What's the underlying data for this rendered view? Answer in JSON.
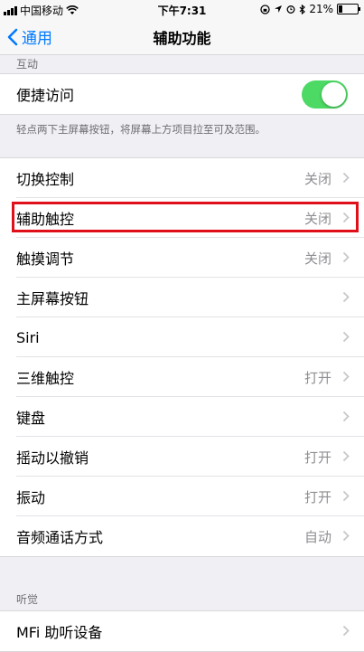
{
  "status": {
    "carrier": "中国移动",
    "time": "下午7:31",
    "battery": "21%",
    "battery_level": 0.21
  },
  "nav": {
    "back_label": "通用",
    "title": "辅助功能"
  },
  "section_interaction": {
    "header": "互动",
    "toggle_row": {
      "label": "便捷访问",
      "toggle_on": true
    },
    "footer": "轻点两下主屏幕按钮，将屏幕上方项目拉至可及范围。"
  },
  "list": [
    {
      "label": "切换控制",
      "value": "关闭"
    },
    {
      "label": "辅助触控",
      "value": "关闭"
    },
    {
      "label": "触摸调节",
      "value": "关闭"
    },
    {
      "label": "主屏幕按钮",
      "value": ""
    },
    {
      "label": "Siri",
      "value": ""
    },
    {
      "label": "三维触控",
      "value": "打开"
    },
    {
      "label": "键盘",
      "value": ""
    },
    {
      "label": "摇动以撤销",
      "value": "打开"
    },
    {
      "label": "振动",
      "value": "打开"
    },
    {
      "label": "音频通话方式",
      "value": "自动"
    }
  ],
  "section_hearing": {
    "header": "听觉",
    "rows": [
      {
        "label": "MFi 助听设备",
        "value": ""
      }
    ]
  },
  "colors": {
    "accent": "#007aff",
    "toggle_on": "#4cd964",
    "highlight": "#e0101a"
  }
}
